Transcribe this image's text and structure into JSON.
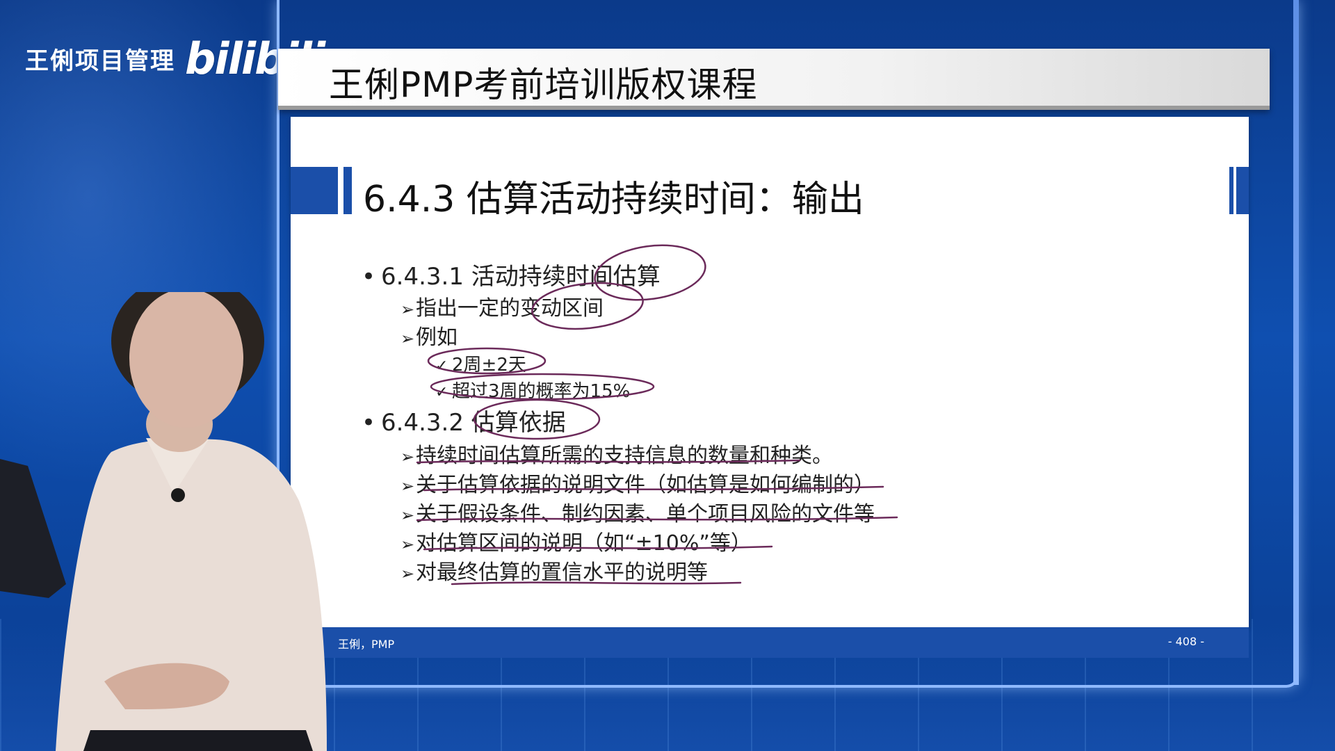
{
  "watermark": {
    "channel": "王俐项目管理",
    "logo": "bilibili"
  },
  "course": {
    "title": "王俐PMP考前培训版权课程"
  },
  "slide": {
    "section_title": "6.4.3 估算活动持续时间：输出",
    "items": [
      {
        "label": "6.4.3.1 活动持续时间估算",
        "children": [
          {
            "label": "指出一定的变动区间",
            "children": []
          },
          {
            "label": "例如",
            "children": [
              {
                "label": "2周±2天"
              },
              {
                "label": "超过3周的概率为15%"
              }
            ]
          }
        ]
      },
      {
        "label": "6.4.3.2 估算依据",
        "children": [
          {
            "label": "持续时间估算所需的支持信息的数量和种类。",
            "children": []
          },
          {
            "label": "关于估算依据的说明文件（如估算是如何编制的）",
            "children": []
          },
          {
            "label": "关于假设条件、制约因素、单个项目风险的文件等",
            "children": []
          },
          {
            "label": "对估算区间的说明（如“±10%”等）",
            "children": []
          },
          {
            "label": "对最终估算的置信水平的说明等",
            "children": []
          }
        ]
      }
    ],
    "footer_left": "王俐，PMP",
    "footer_right": "- 408 -"
  },
  "icons": {
    "bullet_l1": "•",
    "bullet_l2": "➢",
    "bullet_l3": "✓"
  },
  "colors": {
    "background": "#0f4fb0",
    "slide_accent": "#1b4fa9",
    "annotation_ink": "#6b2a5a"
  }
}
